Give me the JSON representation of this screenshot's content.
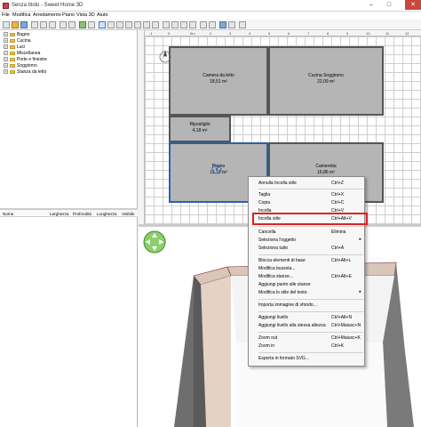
{
  "window": {
    "title": "Senza titolo - Sweet Home 3D",
    "minimize": "–",
    "maximize": "□",
    "close": "✕"
  },
  "menu": [
    "File",
    "Modifica",
    "Arredamento",
    "Piano",
    "Vista 3D",
    "Aiuto"
  ],
  "tree": [
    {
      "label": "Bagno"
    },
    {
      "label": "Cucina"
    },
    {
      "label": "Luci"
    },
    {
      "label": "Miscellanea"
    },
    {
      "label": "Porte e finestre"
    },
    {
      "label": "Soggiorno"
    },
    {
      "label": "Stanza da letto"
    }
  ],
  "furniture_table": {
    "columns": [
      "Nome",
      "Larghezza",
      "Profondità",
      "Lunghezza",
      "Visibile"
    ]
  },
  "ruler": {
    "top": [
      "-1",
      "0",
      "1",
      "2",
      "3",
      "4",
      "5",
      "6",
      "7",
      "8",
      "9",
      "10",
      "11",
      "12",
      "13",
      "14"
    ],
    "mark": "0m"
  },
  "rooms": [
    {
      "name": "Camera da letto",
      "area": "18,51 m²"
    },
    {
      "name": "Cucina Soggiorno",
      "area": "22,09 m²"
    },
    {
      "name": "Ripostiglio",
      "area": "4,18 m²"
    },
    {
      "name": "Bagno",
      "area": "15,19 m²"
    },
    {
      "name": "Cameretta",
      "area": "16,86 m²"
    }
  ],
  "context_menu": {
    "items": [
      {
        "label": "Annulla Incolla stile",
        "shortcut": "Ctrl+Z"
      },
      {
        "label": "Taglia",
        "shortcut": "Ctrl+X"
      },
      {
        "label": "Copia",
        "shortcut": "Ctrl+C"
      },
      {
        "label": "Incolla",
        "shortcut": "Ctrl+V"
      },
      {
        "label": "Incolla stile",
        "shortcut": "Ctrl+Alt+V"
      },
      {
        "label": "Cancella",
        "shortcut": "Elimina"
      },
      {
        "label": "Seleziona l'oggetto",
        "shortcut": ""
      },
      {
        "label": "Seleziona tutto",
        "shortcut": "Ctrl+A"
      },
      {
        "label": "Blocca elementi di base",
        "shortcut": "Ctrl+Alt+L"
      },
      {
        "label": "Modifica bussola...",
        "shortcut": ""
      },
      {
        "label": "Modifica stanze...",
        "shortcut": "Ctrl+Alt+E"
      },
      {
        "label": "Aggiungi punto alle stanze",
        "shortcut": ""
      },
      {
        "label": "Modifica lo stile del testo",
        "shortcut": ""
      },
      {
        "label": "Importa immagine di sfondo...",
        "shortcut": ""
      },
      {
        "label": "Aggiungi livello",
        "shortcut": "Ctrl+Alt+N"
      },
      {
        "label": "Aggiungi livello alla stessa altezza",
        "shortcut": "Ctrl+Maiusc+N"
      },
      {
        "label": "Zoom out",
        "shortcut": "Ctrl+Maiusc+K"
      },
      {
        "label": "Zoom in",
        "shortcut": "Ctrl+K"
      },
      {
        "label": "Esporta in formato SVG...",
        "shortcut": ""
      }
    ],
    "submenu_arrow": "▸"
  }
}
